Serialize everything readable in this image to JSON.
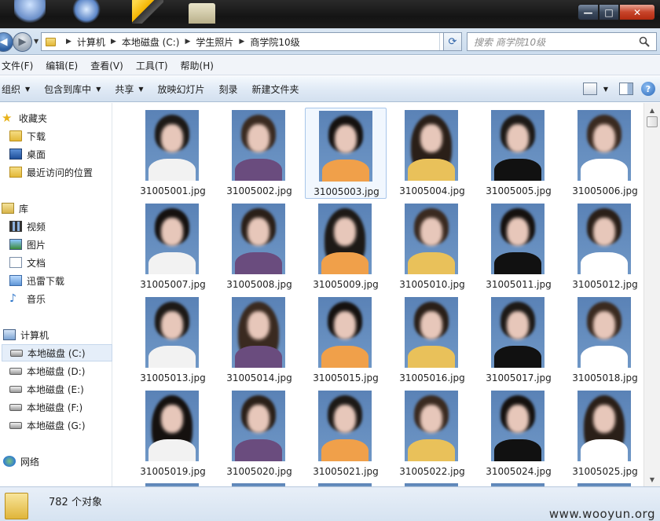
{
  "window": {
    "minimize_glyph": "—",
    "maximize_glyph": "□",
    "close_glyph": "✕"
  },
  "address_bar": {
    "breadcrumb": [
      "计算机",
      "本地磁盘 (C:)",
      "学生照片",
      "商学院10级"
    ],
    "search_placeholder": "搜索 商学院10级"
  },
  "menu": [
    "文件(F)",
    "编辑(E)",
    "查看(V)",
    "工具(T)",
    "帮助(H)"
  ],
  "toolbar": {
    "organize": "组织",
    "include_in_library": "包含到库中",
    "share": "共享",
    "slideshow": "放映幻灯片",
    "burn": "刻录",
    "new_folder": "新建文件夹"
  },
  "sidebar": {
    "favorites": {
      "label": "收藏夹",
      "items": [
        "下载",
        "桌面",
        "最近访问的位置"
      ]
    },
    "libraries": {
      "label": "库",
      "items": [
        "视频",
        "图片",
        "文档",
        "迅雷下载",
        "音乐"
      ]
    },
    "computer": {
      "label": "计算机",
      "items": [
        "本地磁盘 (C:)",
        "本地磁盘 (D:)",
        "本地磁盘 (E:)",
        "本地磁盘 (F:)",
        "本地磁盘 (G:)"
      ],
      "selected": "本地磁盘 (C:)"
    },
    "network": {
      "label": "网络"
    }
  },
  "files": [
    "31005001.jpg",
    "31005002.jpg",
    "31005003.jpg",
    "31005004.jpg",
    "31005005.jpg",
    "31005006.jpg",
    "31005007.jpg",
    "31005008.jpg",
    "31005009.jpg",
    "31005010.jpg",
    "31005011.jpg",
    "31005012.jpg",
    "31005013.jpg",
    "31005014.jpg",
    "31005015.jpg",
    "31005016.jpg",
    "31005017.jpg",
    "31005018.jpg",
    "31005019.jpg",
    "31005020.jpg",
    "31005021.jpg",
    "31005022.jpg",
    "31005024.jpg",
    "31005025.jpg"
  ],
  "selected_file": "31005003.jpg",
  "status": {
    "count": "782 个对象"
  },
  "watermark": "www.wooyun.org",
  "colors": {
    "accent": "#2d62a8",
    "photo_background": "#6a91c3",
    "selection": "#a8c6ea"
  }
}
